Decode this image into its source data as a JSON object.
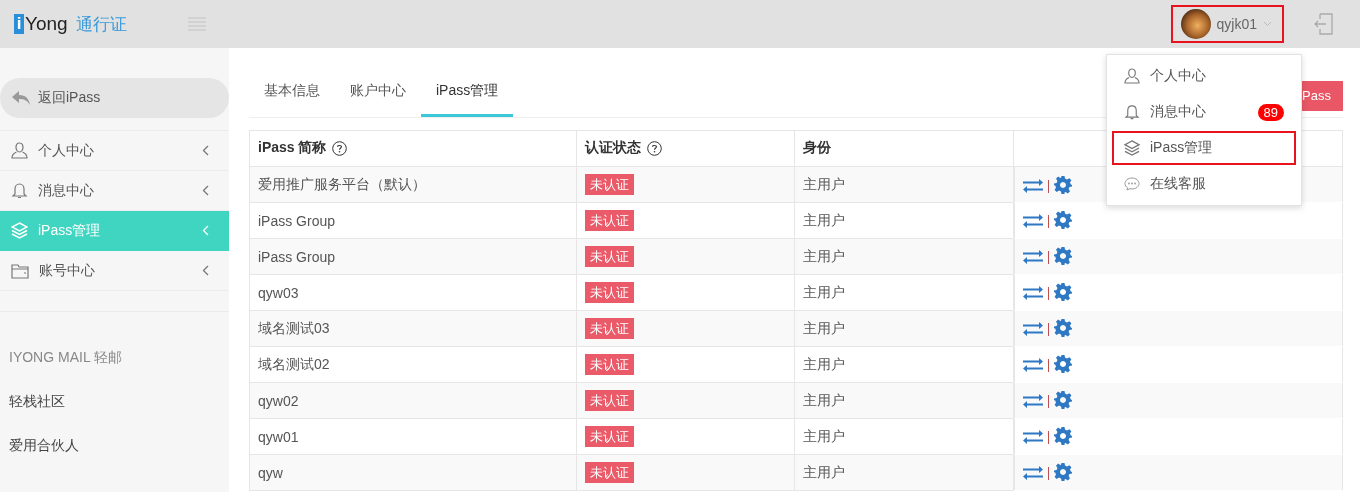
{
  "header": {
    "logo_mark": "i",
    "logo_text": "Yong",
    "product": "通行证",
    "user": {
      "name": "qyjk01",
      "highlighted": true
    }
  },
  "sidebar": {
    "back": "返回iPass",
    "items": [
      {
        "label": "个人中心",
        "kind": "person",
        "selected": false
      },
      {
        "label": "消息中心",
        "kind": "bell",
        "selected": false
      },
      {
        "label": "iPass管理",
        "kind": "layers",
        "selected": true
      },
      {
        "label": "账号中心",
        "kind": "folder",
        "selected": false
      }
    ],
    "links": [
      {
        "label": "IYONG MAIL 轻邮",
        "muted": true
      },
      {
        "label": "轻栈社区",
        "muted": false
      },
      {
        "label": "爱用合伙人",
        "muted": false
      }
    ]
  },
  "tabs": [
    {
      "label": "基本信息",
      "selected": false
    },
    {
      "label": "账户中心",
      "selected": false
    },
    {
      "label": "iPass管理",
      "selected": true
    }
  ],
  "action_button": "Pass",
  "table": {
    "columns": [
      {
        "label": "iPass 简称",
        "help": true
      },
      {
        "label": "认证状态",
        "help": true
      },
      {
        "label": "身份",
        "help": false
      }
    ],
    "rows": [
      {
        "name": "爱用推广服务平台（默认）",
        "status": "未认证",
        "role": "主用户"
      },
      {
        "name": "iPass Group",
        "status": "未认证",
        "role": "主用户"
      },
      {
        "name": "iPass Group",
        "status": "未认证",
        "role": "主用户"
      },
      {
        "name": "qyw03",
        "status": "未认证",
        "role": "主用户"
      },
      {
        "name": "域名测试03",
        "status": "未认证",
        "role": "主用户"
      },
      {
        "name": "域名测试02",
        "status": "未认证",
        "role": "主用户"
      },
      {
        "name": "qyw02",
        "status": "未认证",
        "role": "主用户"
      },
      {
        "name": "qyw01",
        "status": "未认证",
        "role": "主用户"
      },
      {
        "name": "qyw",
        "status": "未认证",
        "role": "主用户"
      }
    ]
  },
  "user_menu": [
    {
      "label": "个人中心",
      "kind": "person",
      "highlighted": false
    },
    {
      "label": "消息中心",
      "kind": "bell",
      "badge": "89",
      "highlighted": false
    },
    {
      "label": "iPass管理",
      "kind": "layers",
      "highlighted": true
    },
    {
      "label": "在线客服",
      "kind": "chat",
      "highlighted": false
    }
  ]
}
